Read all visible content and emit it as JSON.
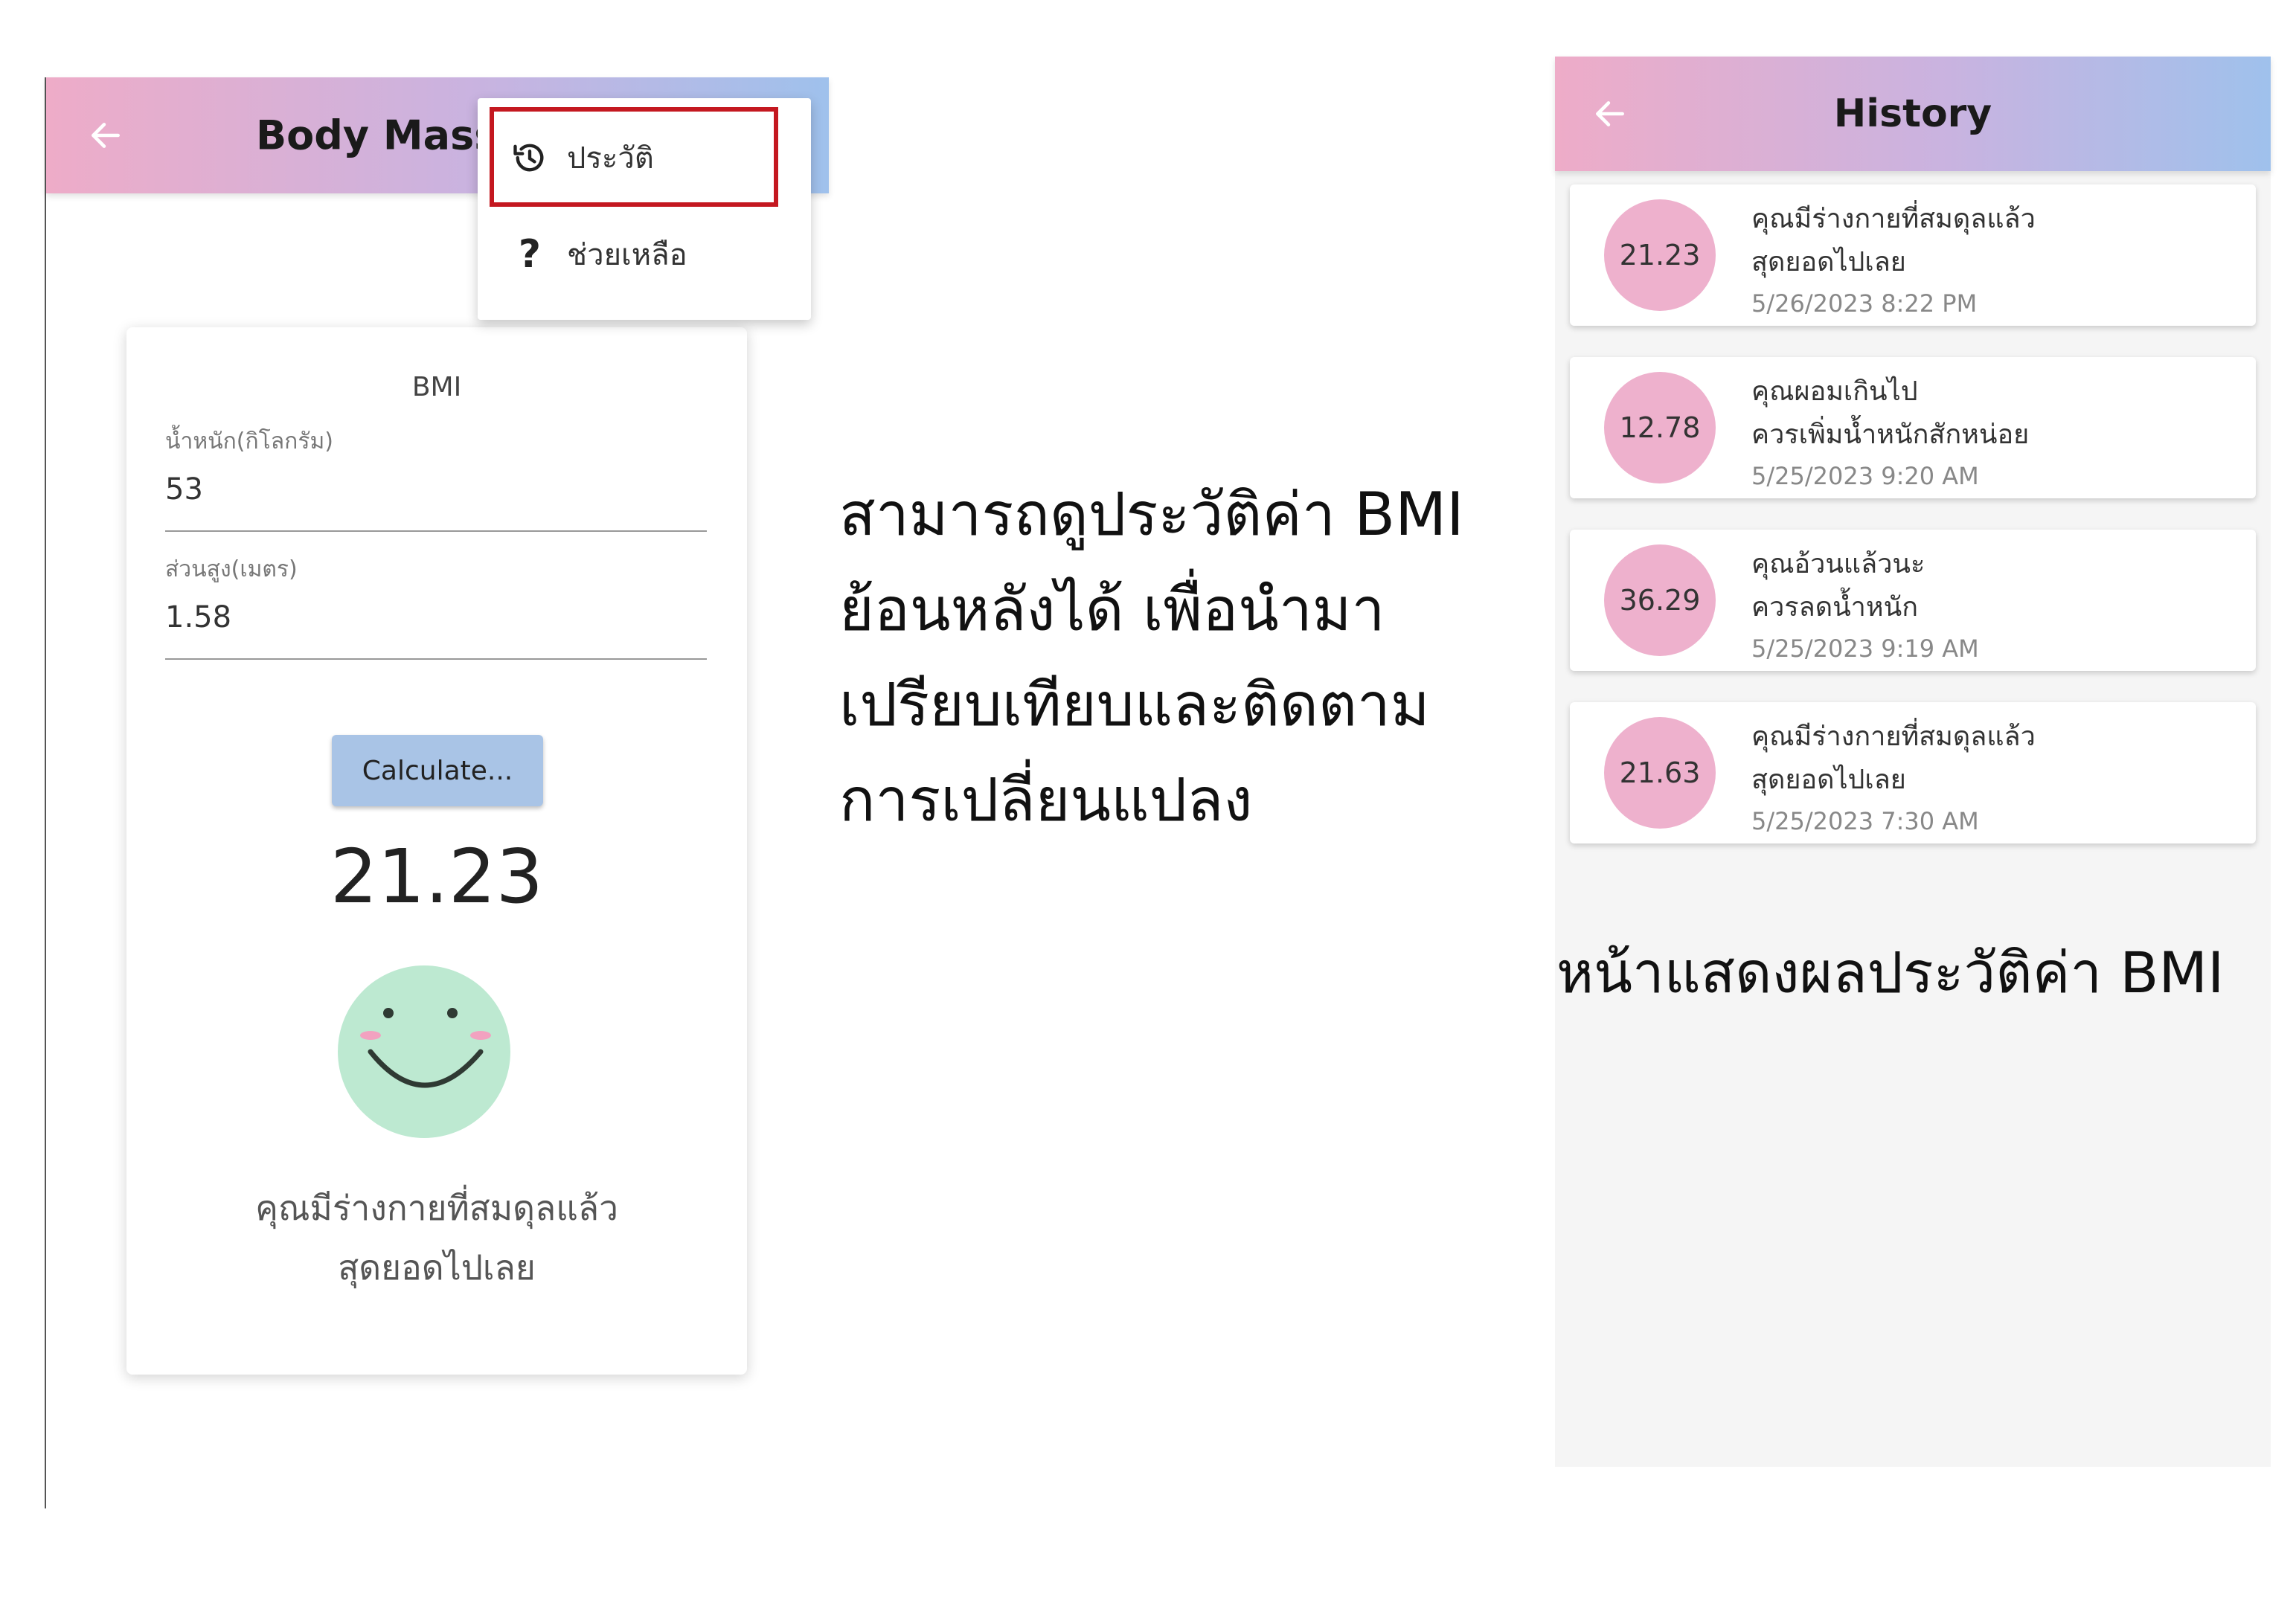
{
  "bmi_screen": {
    "appbar": {
      "title": "Body Mass"
    },
    "menu": {
      "items": [
        {
          "label": "ประวัติ",
          "icon": "history-icon"
        },
        {
          "label": "ช่วยเหลือ",
          "icon": "help-icon"
        }
      ]
    },
    "card": {
      "title": "BMI",
      "weight": {
        "label": "น้ำหนัก(กิโลกรัม)",
        "value": "53"
      },
      "height": {
        "label": "ส่วนสูง(เมตร)",
        "value": "1.58"
      },
      "calculate_label": "Calculate...",
      "bmi_value": "21.23",
      "result_line1": "คุณมีร่างกายที่สมดุลแล้ว",
      "result_line2": "สุดยอดไปเลย"
    }
  },
  "caption_center": {
    "lines": [
      "สามารถดูประวัติค่า BMI",
      "ย้อนหลังได้ เพื่อนำมา",
      "เปรียบเทียบและติดตาม",
      "การเปลี่ยนแปลง"
    ]
  },
  "history_screen": {
    "appbar": {
      "title": "History"
    },
    "items": [
      {
        "bmi": "21.23",
        "line1": "คุณมีร่างกายที่สมดุลแล้ว",
        "line2": "สุดยอดไปเลย",
        "date": "5/26/2023 8:22 PM"
      },
      {
        "bmi": "12.78",
        "line1": "คุณผอมเกินไป",
        "line2": "ควรเพิ่มน้ำหนักสักหน่อย",
        "date": "5/25/2023 9:20 AM"
      },
      {
        "bmi": "36.29",
        "line1": "คุณอ้วนแล้วนะ",
        "line2": "ควรลดน้ำหนัก",
        "date": "5/25/2023 9:19 AM"
      },
      {
        "bmi": "21.63",
        "line1": "คุณมีร่างกายที่สมดุลแล้ว",
        "line2": "สุดยอดไปเลย",
        "date": "5/25/2023 7:30 AM"
      }
    ]
  },
  "caption_right": "หน้าแสดงผลประวัติค่า BMI",
  "colors": {
    "appbar_gradient": [
      "#eeacc8",
      "#c9b3e0",
      "#9fc1ec"
    ],
    "highlight": "#c41820",
    "calculate_button": "#a9c4e6",
    "history_circle": "#eeb1cd",
    "smiley": "#bde9d1"
  }
}
